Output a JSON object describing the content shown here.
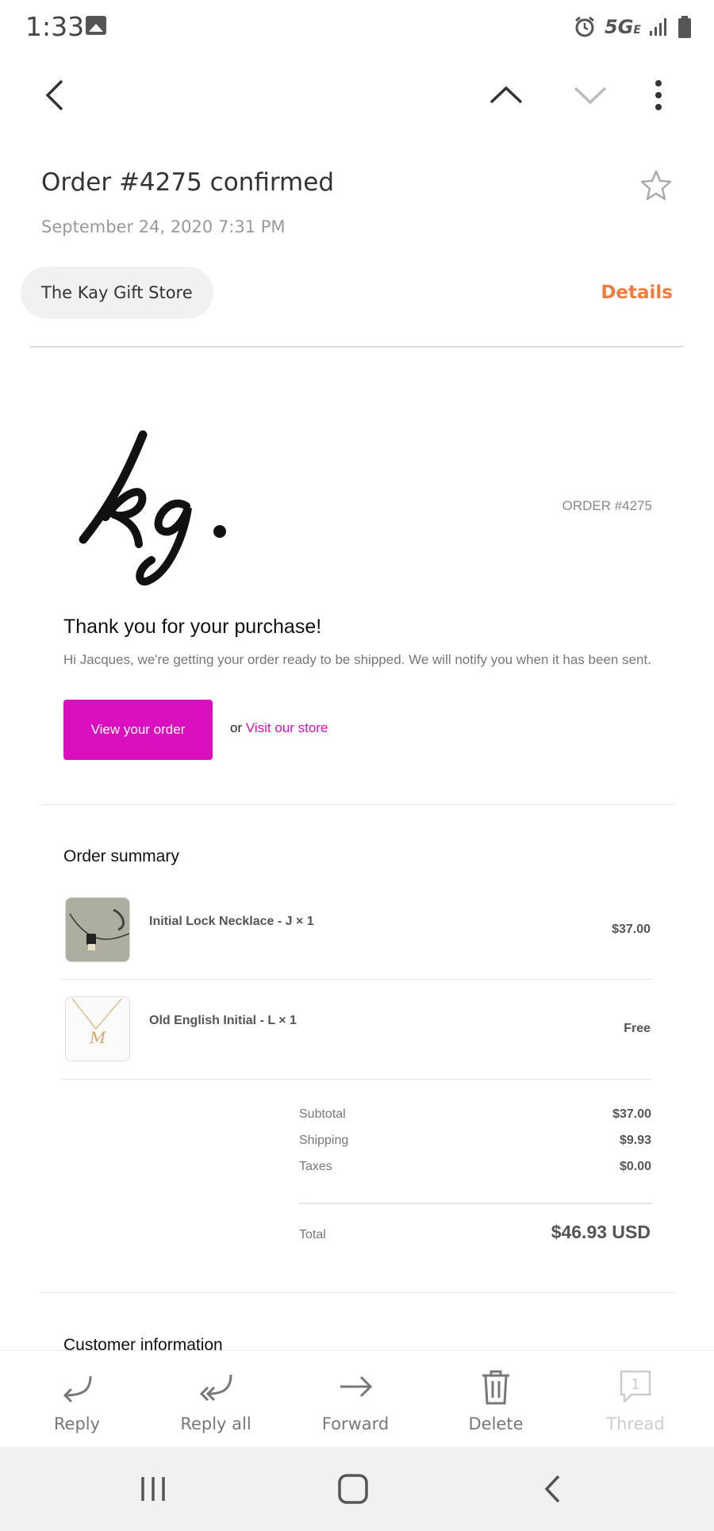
{
  "status_bar": {
    "time": "1:33",
    "network": "5G",
    "network_sub": "E"
  },
  "email": {
    "subject": "Order #4275 confirmed",
    "date": "September 24, 2020  7:31 PM",
    "sender": "The Kay Gift Store",
    "details_label": "Details",
    "body": {
      "order_number": "ORDER #4275",
      "thank_you": "Thank you for your purchase!",
      "intro": "Hi Jacques, we're getting your order ready to be shipped. We will notify you when it has been sent.",
      "view_order_label": "View your order",
      "or_text": "or ",
      "visit_store_label": "Visit our store",
      "order_summary_title": "Order summary",
      "items": [
        {
          "name": "Initial Lock Necklace - J × 1",
          "price": "$37.00",
          "thumb_icon": "necklace-photo"
        },
        {
          "name": "Old English Initial - L × 1",
          "price": "Free",
          "thumb_icon": "initial-pendant-photo"
        }
      ],
      "totals": [
        {
          "label": "Subtotal",
          "value": "$37.00"
        },
        {
          "label": "Shipping",
          "value": "$9.93"
        },
        {
          "label": "Taxes",
          "value": "$0.00"
        }
      ],
      "total_label": "Total",
      "total_value": "$46.93 USD",
      "customer_info_title": "Customer information"
    }
  },
  "actions": [
    {
      "label": "Reply",
      "icon": "reply-icon"
    },
    {
      "label": "Reply all",
      "icon": "reply-all-icon"
    },
    {
      "label": "Forward",
      "icon": "forward-icon"
    },
    {
      "label": "Delete",
      "icon": "trash-icon"
    },
    {
      "label": "Thread",
      "icon": "thread-icon",
      "badge": "1"
    }
  ],
  "colors": {
    "accent_button": "#d90fbf",
    "details_link": "#f07b3f"
  }
}
